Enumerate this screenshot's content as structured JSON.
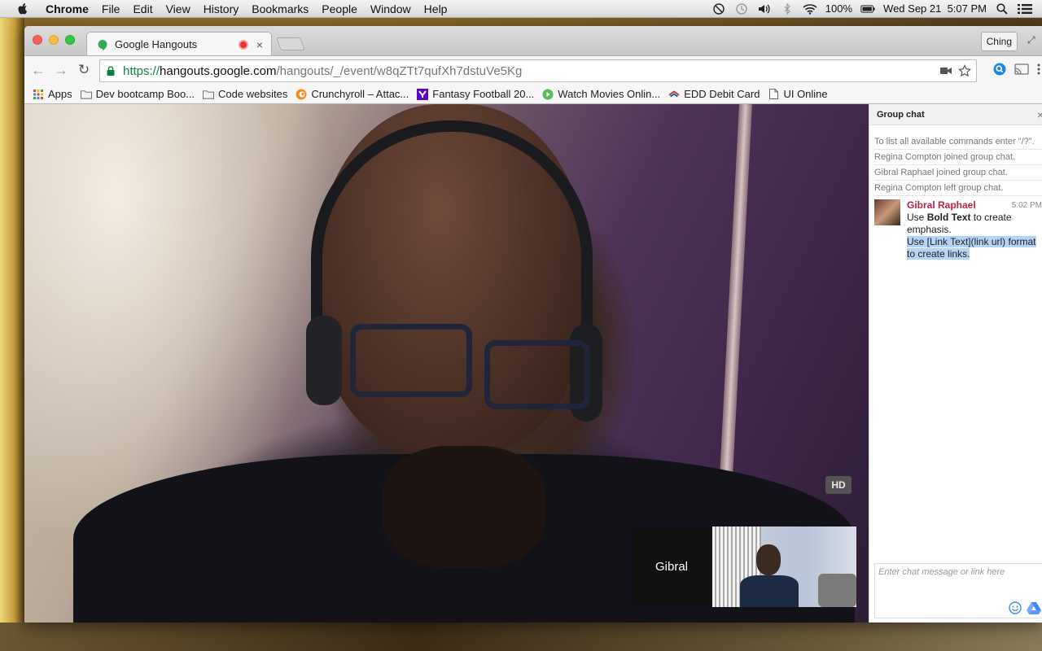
{
  "menubar": {
    "app": "Chrome",
    "items": [
      "File",
      "Edit",
      "View",
      "History",
      "Bookmarks",
      "People",
      "Window",
      "Help"
    ],
    "battery": "100%",
    "datetime": "Wed Sep 21  5:07 PM"
  },
  "tab": {
    "title": "Google Hangouts",
    "close": "×"
  },
  "profile": "Ching",
  "url": {
    "scheme": "https://",
    "host": "hangouts.google.com",
    "path": "/hangouts/_/event/w8qZTt7qufXh7dstuVe5Kg"
  },
  "bookmarks": [
    {
      "label": "Apps",
      "icon": "apps-grid-icon"
    },
    {
      "label": "Dev bootcamp Boo...",
      "icon": "folder-icon"
    },
    {
      "label": "Code websites",
      "icon": "folder-icon"
    },
    {
      "label": "Crunchyroll – Attac...",
      "icon": "crunchyroll-icon"
    },
    {
      "label": "Fantasy Football 20...",
      "icon": "yahoo-icon"
    },
    {
      "label": "Watch Movies Onlin...",
      "icon": "play-icon"
    },
    {
      "label": "EDD Debit Card",
      "icon": "bank-icon"
    },
    {
      "label": "UI Online",
      "icon": "page-icon"
    }
  ],
  "video": {
    "hd": "HD",
    "participant": "Gibral"
  },
  "chat": {
    "title": "Group chat",
    "system_messages": [
      "To list all available commands enter \"/?\".",
      "Regina Compton joined group chat.",
      "Gibral Raphael joined group chat.",
      "Regina Compton left group chat."
    ],
    "message": {
      "author": "Gibral Raphael",
      "time": "5:02 PM",
      "line1_pre": "Use ",
      "line1_bold": "Bold Text",
      "line1_post": " to create emphasis.",
      "line2": "Use [Link Text](link url) format to create links."
    },
    "input_placeholder": "Enter chat message or link here"
  },
  "colors": {
    "author": "#b8234a",
    "url_scheme": "#0b8043",
    "highlight": "#b5d3f5"
  }
}
